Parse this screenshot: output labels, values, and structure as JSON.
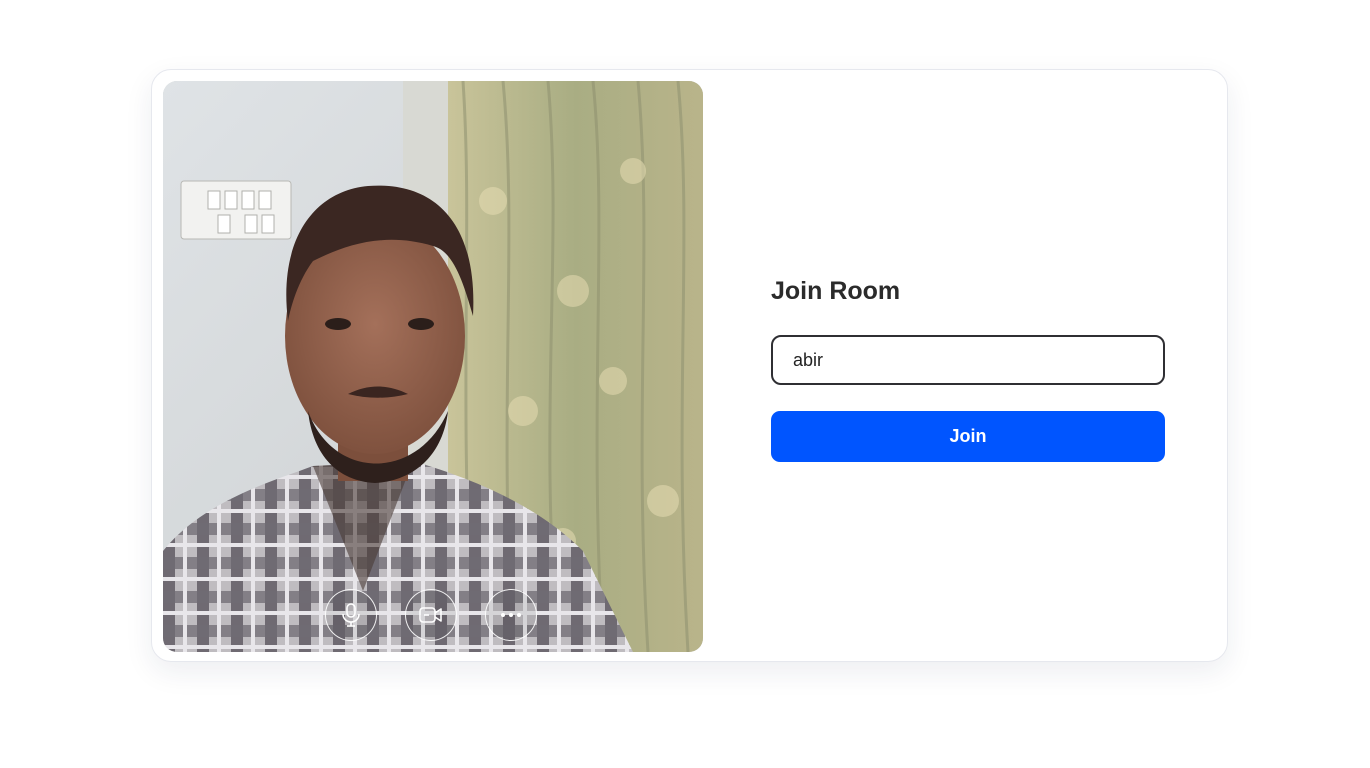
{
  "join_room": {
    "title": "Join Room",
    "name_value": "abir",
    "join_label": "Join"
  },
  "video_preview": {
    "controls": [
      {
        "icon": "microphone-icon"
      },
      {
        "icon": "video-camera-icon"
      },
      {
        "icon": "more-options-icon"
      }
    ]
  },
  "colors": {
    "accent": "#0055ff",
    "input_border": "#2f2f33",
    "title_text": "#2b2b2b"
  }
}
